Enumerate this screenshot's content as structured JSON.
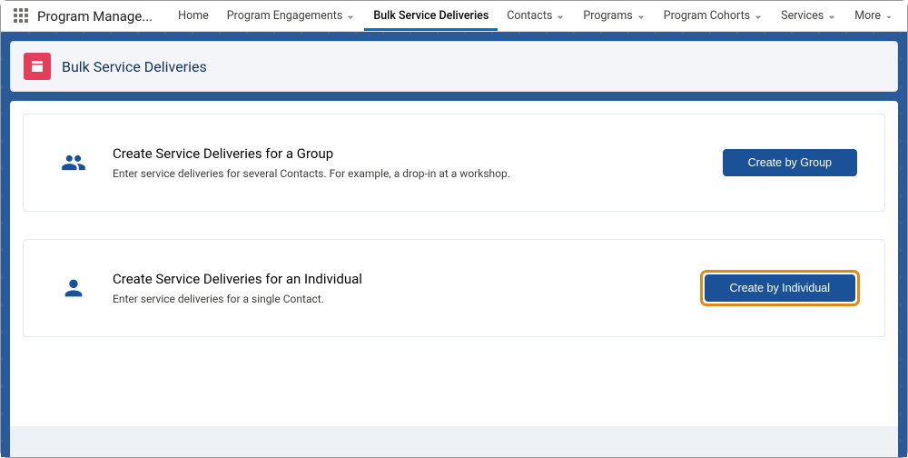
{
  "app_name": "Program Manage...",
  "nav": [
    {
      "label": "Home",
      "dropdown": false,
      "active": false
    },
    {
      "label": "Program Engagements",
      "dropdown": true,
      "active": false
    },
    {
      "label": "Bulk Service Deliveries",
      "dropdown": false,
      "active": true
    },
    {
      "label": "Contacts",
      "dropdown": true,
      "active": false
    },
    {
      "label": "Programs",
      "dropdown": true,
      "active": false
    },
    {
      "label": "Program Cohorts",
      "dropdown": true,
      "active": false
    },
    {
      "label": "Services",
      "dropdown": true,
      "active": false
    },
    {
      "label": "More",
      "dropdown": true,
      "active": false,
      "filled_caret": true
    }
  ],
  "page_title": "Bulk Service Deliveries",
  "options": [
    {
      "id": "group",
      "icon": "group-icon",
      "title": "Create Service Deliveries for a Group",
      "desc": "Enter service deliveries for several Contacts. For example, a drop-in at a workshop.",
      "button": "Create by Group",
      "highlighted": false
    },
    {
      "id": "individual",
      "icon": "person-icon",
      "title": "Create Service Deliveries for an Individual",
      "desc": "Enter service deliveries for a single Contact.",
      "button": "Create by Individual",
      "highlighted": true
    }
  ]
}
